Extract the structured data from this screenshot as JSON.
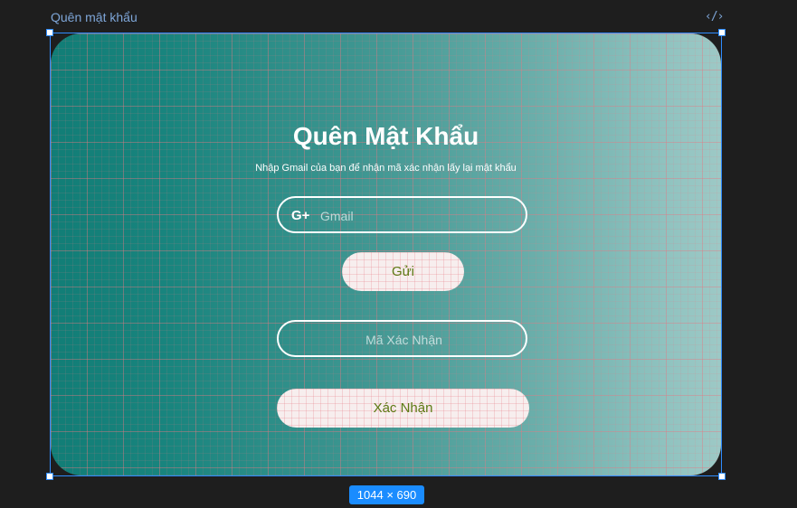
{
  "frame": {
    "title": "Quên mật khẩu",
    "code_icon": "‹/›",
    "size_label": "1044 × 690"
  },
  "form": {
    "title": "Quên Mật Khẩu",
    "subtitle": "Nhập Gmail của bạn để nhận mã xác nhận lấy lại mật khẩu",
    "gmail_icon": "google-plus-icon",
    "gmail_icon_glyph": "G+",
    "gmail_placeholder": "Gmail",
    "send_label": "Gửi",
    "code_placeholder": "Mã Xác Nhận",
    "confirm_label": "Xác Nhận"
  },
  "colors": {
    "selection": "#2f8cff",
    "gradient_start": "#117d76",
    "gradient_end": "#9dc9c6",
    "button_text": "#5c7a14",
    "button_bg": "#f7eeee"
  }
}
